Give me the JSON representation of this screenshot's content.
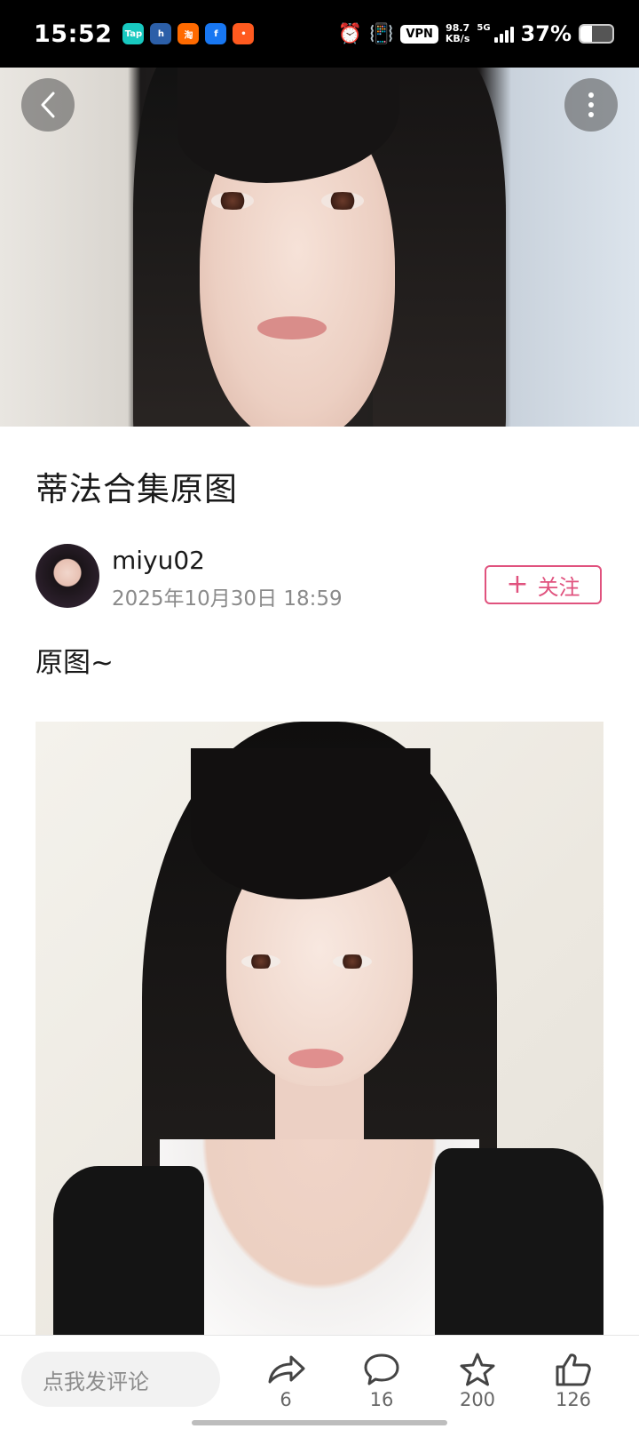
{
  "status_bar": {
    "time": "15:52",
    "apps": [
      {
        "name": "taptap-icon",
        "label": "Tap",
        "color": "#18c9c0"
      },
      {
        "name": "h-app-icon",
        "label": "h",
        "color": "#2c5fa8"
      },
      {
        "name": "taobao-icon",
        "label": "淘",
        "color": "#ff6a00"
      },
      {
        "name": "facebook-icon",
        "label": "f",
        "color": "#1877f2"
      },
      {
        "name": "red-app-icon",
        "label": "•",
        "color": "#ff5a1f"
      }
    ],
    "vpn_label": "VPN",
    "speed_value": "98.7",
    "speed_unit": "KB/s",
    "network": "5G",
    "battery_percent": "37%",
    "battery_level": 0.37
  },
  "post": {
    "title": "蒂法合集原图",
    "author": {
      "name": "miyu02",
      "date": "2025年10月30日 18:59"
    },
    "follow_label": "关注",
    "body": "原图~"
  },
  "bottom_bar": {
    "comment_placeholder": "点我发评论",
    "share_count": "6",
    "comment_count": "16",
    "favorite_count": "200",
    "like_count": "126"
  },
  "colors": {
    "accent": "#e0527e"
  }
}
